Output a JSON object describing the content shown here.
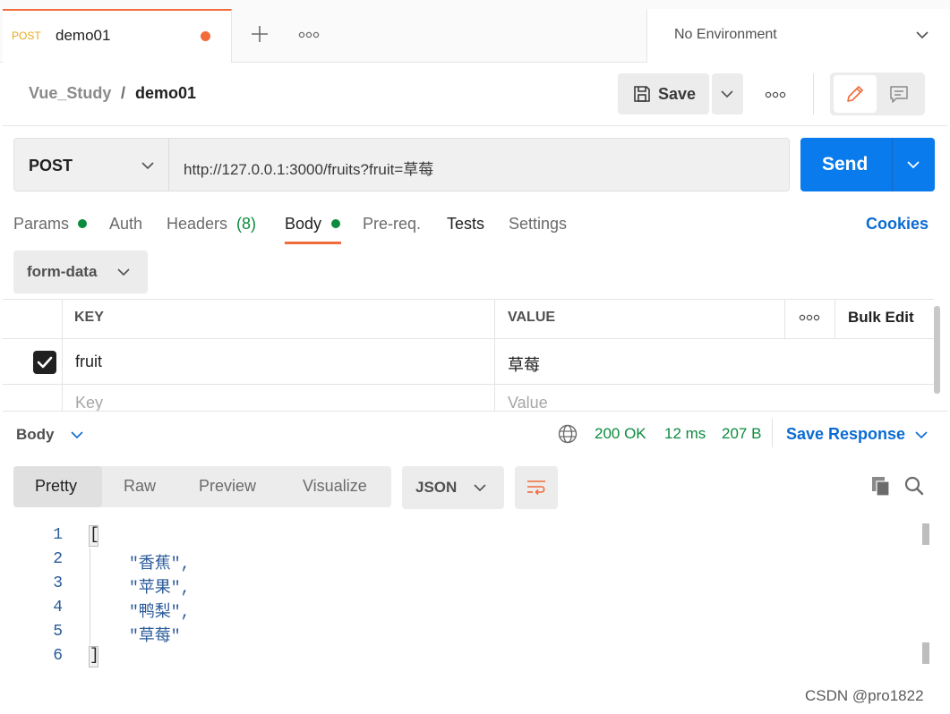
{
  "tab": {
    "method": "POST",
    "name": "demo01"
  },
  "environment": {
    "label": "No Environment"
  },
  "breadcrumb": {
    "collection": "Vue_Study",
    "separator": "/",
    "request": "demo01"
  },
  "toolbar": {
    "save_label": "Save"
  },
  "request": {
    "method": "POST",
    "url": "http://127.0.0.1:3000/fruits?fruit=草莓",
    "send_label": "Send"
  },
  "request_tabs": {
    "params": "Params",
    "auth": "Auth",
    "headers": "Headers",
    "headers_count": "(8)",
    "body": "Body",
    "prereq": "Pre-req.",
    "tests": "Tests",
    "settings": "Settings",
    "cookies": "Cookies"
  },
  "body_type": {
    "selected": "form-data"
  },
  "params_table": {
    "headers": {
      "key": "KEY",
      "value": "VALUE",
      "bulk_edit": "Bulk Edit"
    },
    "rows": [
      {
        "checked": true,
        "key": "fruit",
        "value": "草莓"
      }
    ],
    "placeholders": {
      "key": "Key",
      "value": "Value"
    }
  },
  "response": {
    "body_label": "Body",
    "status": "200 OK",
    "time": "12 ms",
    "size": "207 B",
    "save_response": "Save Response",
    "view_tabs": {
      "pretty": "Pretty",
      "raw": "Raw",
      "preview": "Preview",
      "visualize": "Visualize"
    },
    "format": "JSON",
    "lines": [
      {
        "n": "1",
        "text": "["
      },
      {
        "n": "2",
        "text": "\"香蕉\","
      },
      {
        "n": "3",
        "text": "\"苹果\","
      },
      {
        "n": "4",
        "text": "\"鸭梨\","
      },
      {
        "n": "5",
        "text": "\"草莓\""
      },
      {
        "n": "6",
        "text": "]"
      }
    ]
  },
  "colors": {
    "accent": "#f26b3a",
    "primary": "#097bed",
    "success": "#0b8b3e",
    "link": "#0b6bd3"
  },
  "watermark": "CSDN @pro1822"
}
